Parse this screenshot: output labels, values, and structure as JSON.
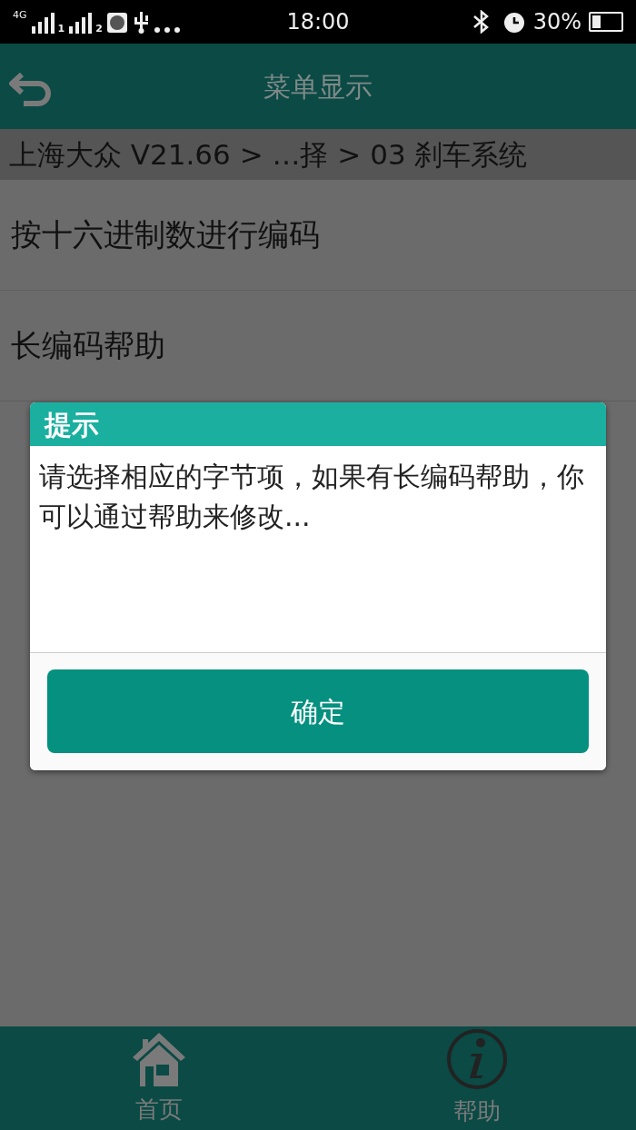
{
  "status_bar": {
    "network": "4G",
    "sims": [
      {
        "label": "1"
      },
      {
        "label": "2"
      }
    ],
    "time": "18:00",
    "battery": "30%"
  },
  "header": {
    "title": "菜单显示"
  },
  "breadcrumb": "上海大众 V21.66 > …择 > 03 刹车系统",
  "menu_items": [
    {
      "label": "按十六进制数进行编码"
    },
    {
      "label": "长编码帮助"
    }
  ],
  "dialog": {
    "title": "提示",
    "message": "请选择相应的字节项，如果有长编码帮助，你可以通过帮助来修改...",
    "button": "确定"
  },
  "bottom_nav": [
    {
      "kind": "home",
      "label": "首页"
    },
    {
      "kind": "info",
      "label": "帮助"
    }
  ]
}
